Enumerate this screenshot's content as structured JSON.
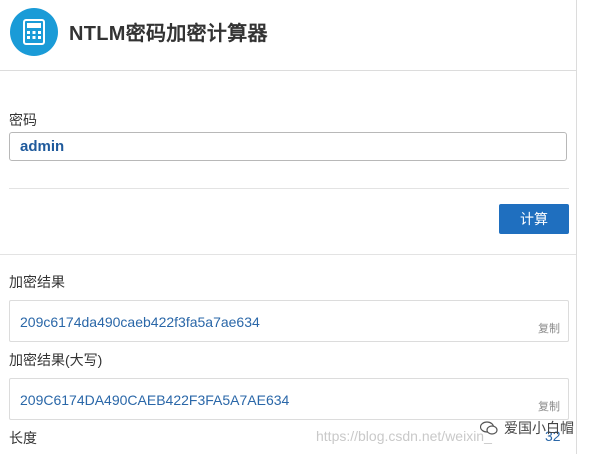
{
  "header": {
    "title": "NTLM密码加密计算器",
    "logo_icon": "calculator-icon"
  },
  "password": {
    "label": "密码",
    "value": "admin"
  },
  "actions": {
    "calculate_label": "计算"
  },
  "result": {
    "label": "加密结果",
    "value": "209c6174da490caeb422f3fa5a7ae634",
    "copy_label": "复制"
  },
  "result_upper": {
    "label": "加密结果(大写)",
    "value": "209C6174DA490CAEB422F3FA5A7AE634",
    "copy_label": "复制"
  },
  "length": {
    "label": "长度",
    "value": "32"
  },
  "watermark": {
    "url": "https://blog.csdn.net/weixin_",
    "author": "爱国小白帽"
  },
  "colors": {
    "accent": "#1f6fbf",
    "logo": "#1a9bd7",
    "result_text": "#2a67a8"
  }
}
